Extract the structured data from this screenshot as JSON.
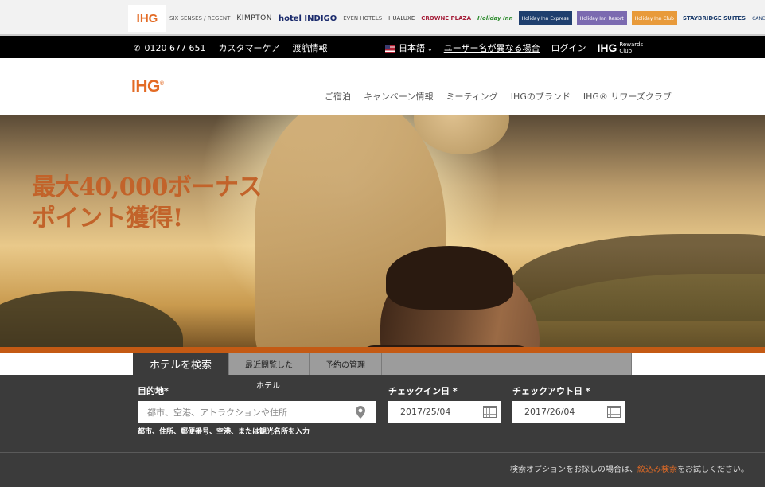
{
  "brands": [
    {
      "name": "IHG",
      "style": "ihg active"
    },
    {
      "name": "SIX SENSES / REGENT",
      "style": "even"
    },
    {
      "name": "KIMPTON",
      "style": "kimpton"
    },
    {
      "name": "hotel INDIGO",
      "style": "indigo"
    },
    {
      "name": "EVEN HOTELS",
      "style": "even"
    },
    {
      "name": "HUALUXE",
      "style": "hualuxe"
    },
    {
      "name": "CROWNE PLAZA",
      "style": "crowne"
    },
    {
      "name": "Holiday Inn",
      "style": "hi"
    },
    {
      "name": "Holiday Inn Express",
      "style": "boxed",
      "color": "#1f3f6e"
    },
    {
      "name": "Holiday Inn Resort",
      "style": "boxed",
      "color": "#7b6ab0"
    },
    {
      "name": "Holiday Inn Club",
      "style": "boxed",
      "color": "#e89a3a"
    },
    {
      "name": "STAYBRIDGE SUITES",
      "style": "stay"
    },
    {
      "name": "CANDLEWOOD SUITES",
      "style": "candle"
    }
  ],
  "utility": {
    "phone": "0120 677 651",
    "customer_care": "カスタマーケア",
    "travel_info": "渡航情報",
    "language": "日本語",
    "username_link": "ユーザー名が異なる場合",
    "login": "ログイン",
    "rewards_brand": "IHG",
    "rewards_sub1": "Rewards",
    "rewards_sub2": "Club"
  },
  "header": {
    "logo": "IHG",
    "nav": [
      "ご宿泊",
      "キャンペーン情報",
      "ミーティング",
      "IHGのブランド",
      "IHG® リワーズクラブ"
    ]
  },
  "hero": {
    "headline_line1": "最大40,000ボーナス",
    "headline_line2": "ポイント獲得!"
  },
  "search": {
    "tabs": [
      "ホテルを検索",
      "最近閲覧した",
      "予約の管理"
    ],
    "tab_sub": "ホテル",
    "destination_label": "目的地*",
    "destination_placeholder": "都市、空港、アトラクションや住所",
    "destination_hint": "都市、住所、郵便番号、空港、または観光名所を入力",
    "checkin_label": "チェックイン日 *",
    "checkin_value": "2017/25/04",
    "checkout_label": "チェックアウト日 *",
    "checkout_value": "2017/26/04",
    "footer_pre": "検索オプションをお探しの場合は、",
    "footer_link": "絞込み検索",
    "footer_post": "をお試しください。"
  },
  "colors": {
    "brand_orange": "#e36b25",
    "panel_dark": "#3b3b3b",
    "tab_grey": "#9c9c9c"
  }
}
